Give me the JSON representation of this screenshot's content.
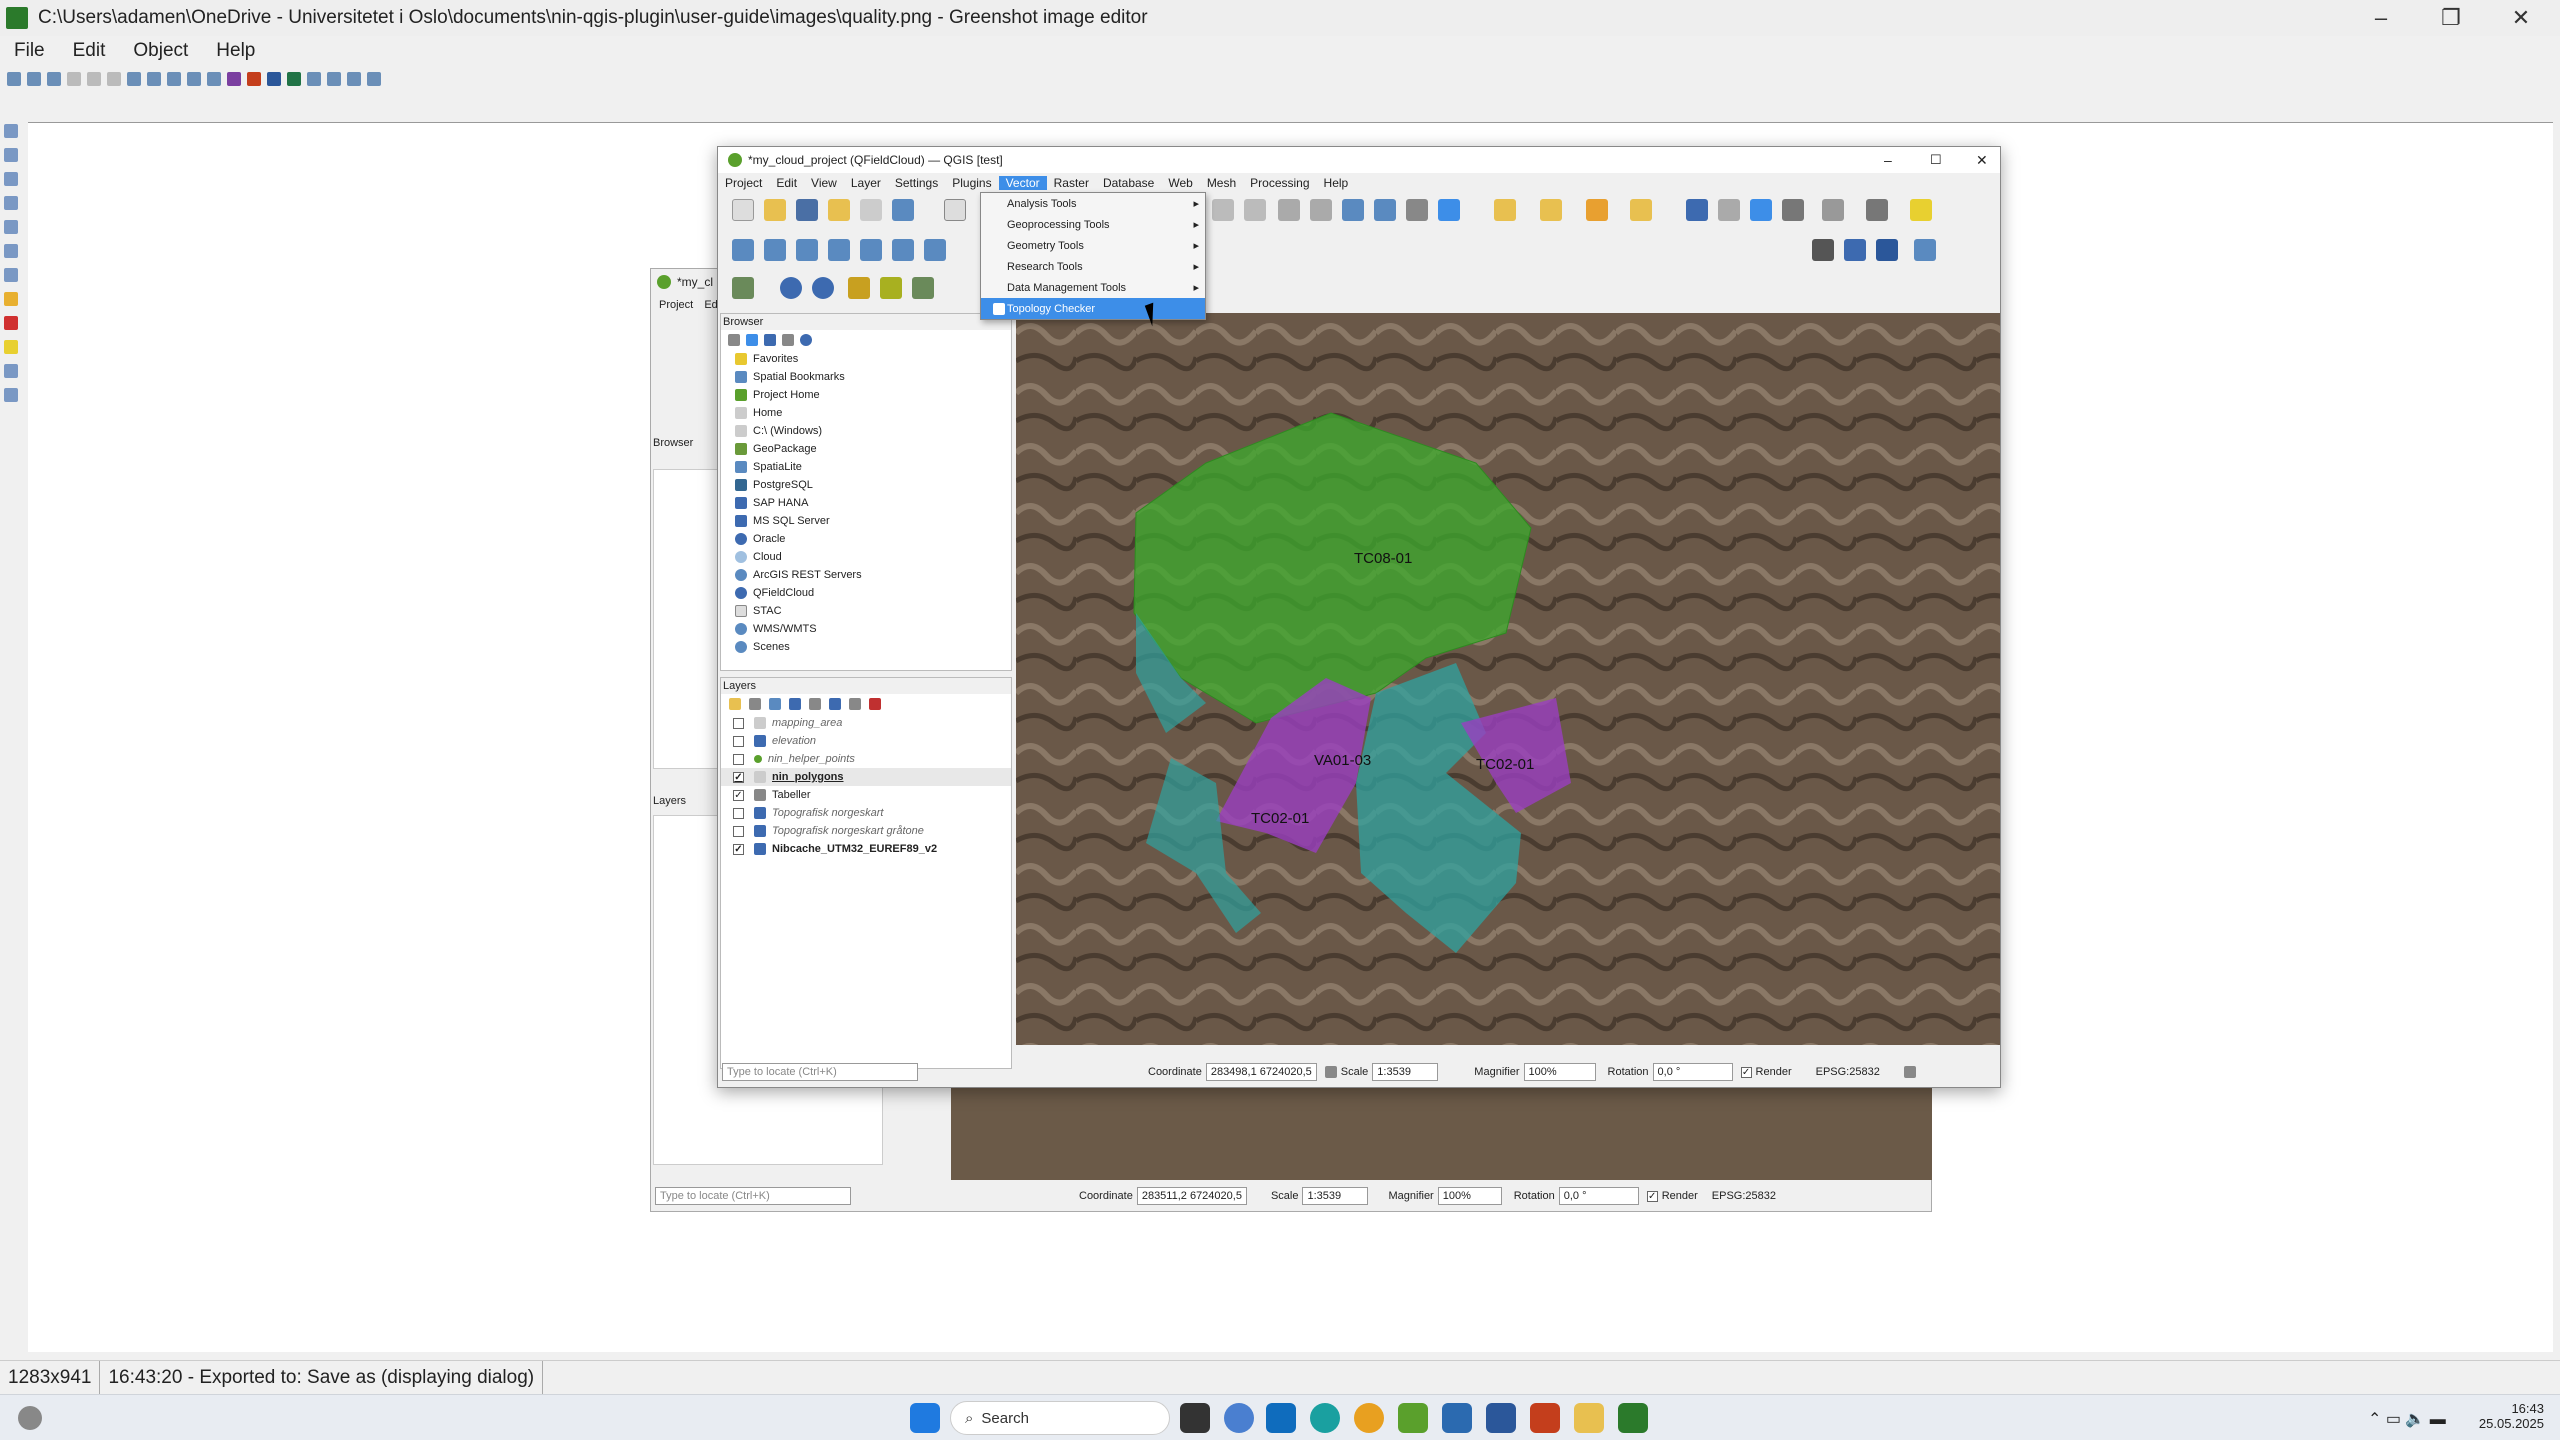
{
  "window": {
    "title": "C:\\Users\\adamen\\OneDrive - Universitetet i Oslo\\documents\\nin-qgis-plugin\\user-guide\\images\\quality.png - Greenshot image editor",
    "menu": [
      "File",
      "Edit",
      "Object",
      "Help"
    ]
  },
  "status": {
    "size": "1283x941",
    "message": "16:43:20 - Exported to: Save as (displaying dialog)"
  },
  "taskbar": {
    "search_placeholder": "Search",
    "time": "16:43",
    "date": "25.05.2025"
  },
  "qgis": {
    "title": "*my_cloud_project (QFieldCloud) — QGIS [test]",
    "menu": [
      "Project",
      "Edit",
      "View",
      "Layer",
      "Settings",
      "Plugins",
      "Vector",
      "Raster",
      "Database",
      "Web",
      "Mesh",
      "Processing",
      "Help"
    ],
    "vector_menu": [
      "Analysis Tools",
      "Geoprocessing Tools",
      "Geometry Tools",
      "Research Tools",
      "Data Management Tools",
      "Topology Checker"
    ],
    "browser_title": "Browser",
    "browser_items": [
      "Favorites",
      "Spatial Bookmarks",
      "Project Home",
      "Home",
      "C:\\ (Windows)",
      "GeoPackage",
      "SpatiaLite",
      "PostgreSQL",
      "SAP HANA",
      "MS SQL Server",
      "Oracle",
      "Cloud",
      "ArcGIS REST Servers",
      "QFieldCloud",
      "STAC",
      "WMS/WMTS",
      "Scenes"
    ],
    "layers_title": "Layers",
    "layers": [
      {
        "name": "mapping_area",
        "checked": false
      },
      {
        "name": "elevation",
        "checked": false
      },
      {
        "name": "nin_helper_points",
        "checked": false
      },
      {
        "name": "nin_polygons",
        "checked": true
      },
      {
        "name": "Tabeller",
        "checked": true
      },
      {
        "name": "Topografisk norgeskart",
        "checked": false
      },
      {
        "name": "Topografisk norgeskart gråtone",
        "checked": false
      },
      {
        "name": "Nibcache_UTM32_EUREF89_v2",
        "checked": true
      }
    ],
    "locate_placeholder": "Type to locate (Ctrl+K)",
    "statusbar": {
      "coordinate_label": "Coordinate",
      "coordinate": "283498,1  6724020,5",
      "scale_label": "Scale",
      "scale": "1:3539",
      "magnifier_label": "Magnifier",
      "magnifier": "100%",
      "rotation_label": "Rotation",
      "rotation": "0,0 °",
      "render": "Render",
      "crs": "EPSG:25832"
    },
    "map_labels": [
      "TC08-01",
      "VA01-03",
      "TC02-01",
      "TC02-01"
    ]
  },
  "qgis_bg": {
    "title": "*my_cl",
    "menu": [
      "Project",
      "Ed"
    ],
    "browser_title": "Browser",
    "layers_title": "Layers",
    "statusbar": {
      "coordinate_label": "Coordinate",
      "coordinate": "283511,2  6724020,5",
      "scale_label": "Scale",
      "scale": "1:3539",
      "magnifier_label": "Magnifier",
      "magnifier": "100%",
      "rotation_label": "Rotation",
      "rotation": "0,0 °",
      "render": "Render",
      "crs": "EPSG:25832"
    }
  },
  "colors": {
    "green_polygon": "#3cab2c",
    "purple_polygon": "#9a3fc0",
    "teal_polygon": "#2fa3a0",
    "accent": "#3d8ee8"
  }
}
